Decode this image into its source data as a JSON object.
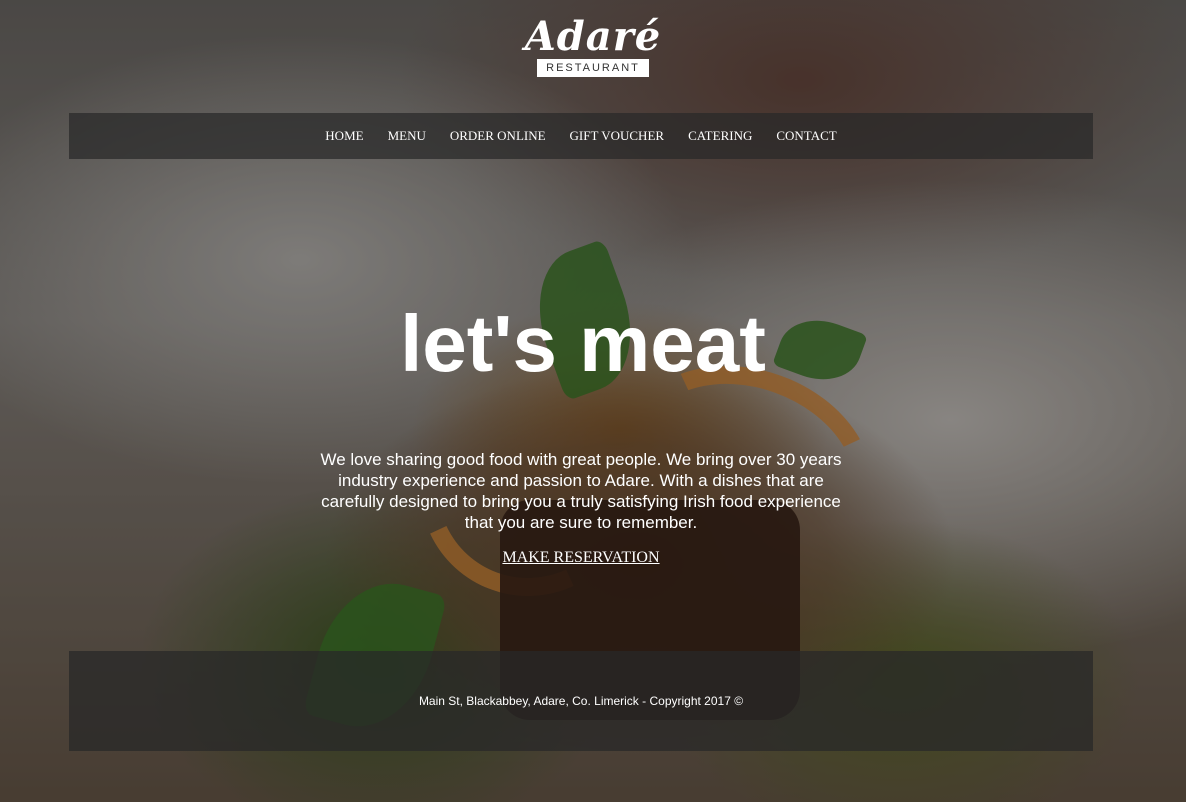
{
  "logo": {
    "name": "Adaré",
    "subtitle": "RESTAURANT"
  },
  "nav": {
    "items": [
      {
        "label": "HOME"
      },
      {
        "label": "MENU"
      },
      {
        "label": "ORDER ONLINE"
      },
      {
        "label": "GIFT VOUCHER"
      },
      {
        "label": "CATERING"
      },
      {
        "label": "CONTACT"
      }
    ]
  },
  "hero": {
    "headline": "let's meat",
    "intro": "We love sharing good food with great people. We bring over 30 years industry experience and passion to Adare. With a dishes that are carefully designed to bring you a truly satisfying Irish food experience that you are sure to remember.",
    "cta_label": "MAKE RESERVATION"
  },
  "footer": {
    "text": "Main St, Blackabbey, Adare, Co. Limerick - Copyright 2017 ©"
  }
}
